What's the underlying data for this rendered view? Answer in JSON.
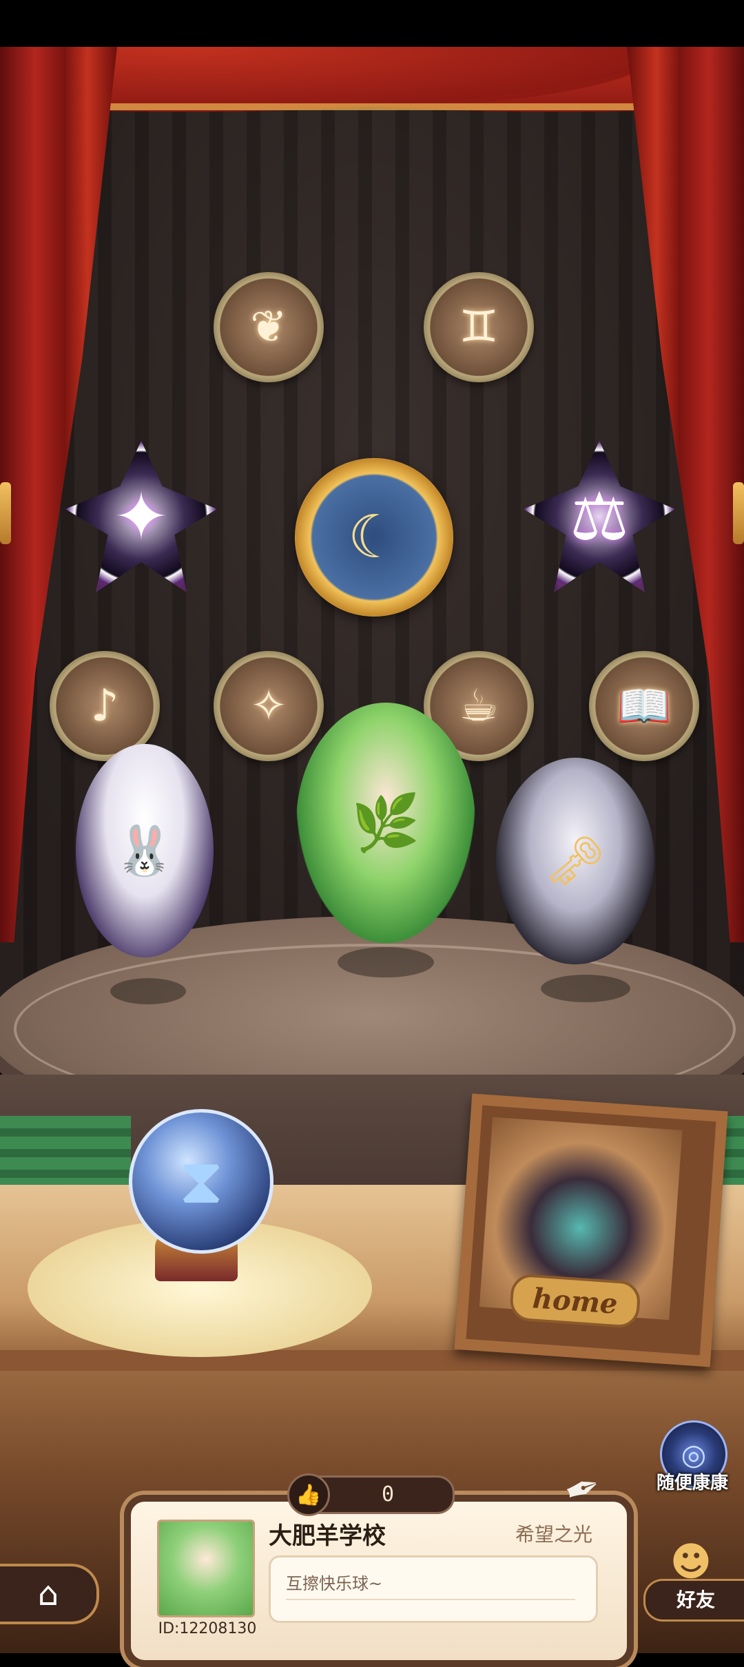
{
  "stage": {
    "badges_top": [
      {
        "name": "badge-plant",
        "glyph": "❦"
      },
      {
        "name": "badge-twins",
        "glyph": "♊"
      }
    ],
    "badges_middle": [
      {
        "name": "badge-compass",
        "glyph": "✦"
      },
      {
        "name": "badge-rabbit-moon",
        "glyph": "☾"
      },
      {
        "name": "badge-scales",
        "glyph": "⚖"
      }
    ],
    "badges_bottom": [
      {
        "name": "badge-music",
        "glyph": "♪"
      },
      {
        "name": "badge-fairy",
        "glyph": "✧"
      },
      {
        "name": "badge-teacup",
        "glyph": "☕"
      },
      {
        "name": "badge-book",
        "glyph": "📖"
      }
    ],
    "characters": [
      {
        "name": "bunny-girl",
        "glyph": "🐰"
      },
      {
        "name": "green-hair-girl",
        "glyph": "🌿"
      },
      {
        "name": "witch-girl",
        "glyph": "🗝"
      }
    ]
  },
  "props": {
    "orb_glyph": "⧗",
    "frame_label": "home"
  },
  "like": {
    "icon": "👍",
    "count": "0"
  },
  "profile": {
    "name": "大肥羊学校",
    "title": "希望之光",
    "motto": "互擦快乐球~",
    "id_label": "ID:12208130"
  },
  "nav": {
    "home_icon": "⌂",
    "random_label": "随便康康",
    "random_icon": "◎",
    "friends_label": "好友",
    "friends_icon": "☻"
  }
}
